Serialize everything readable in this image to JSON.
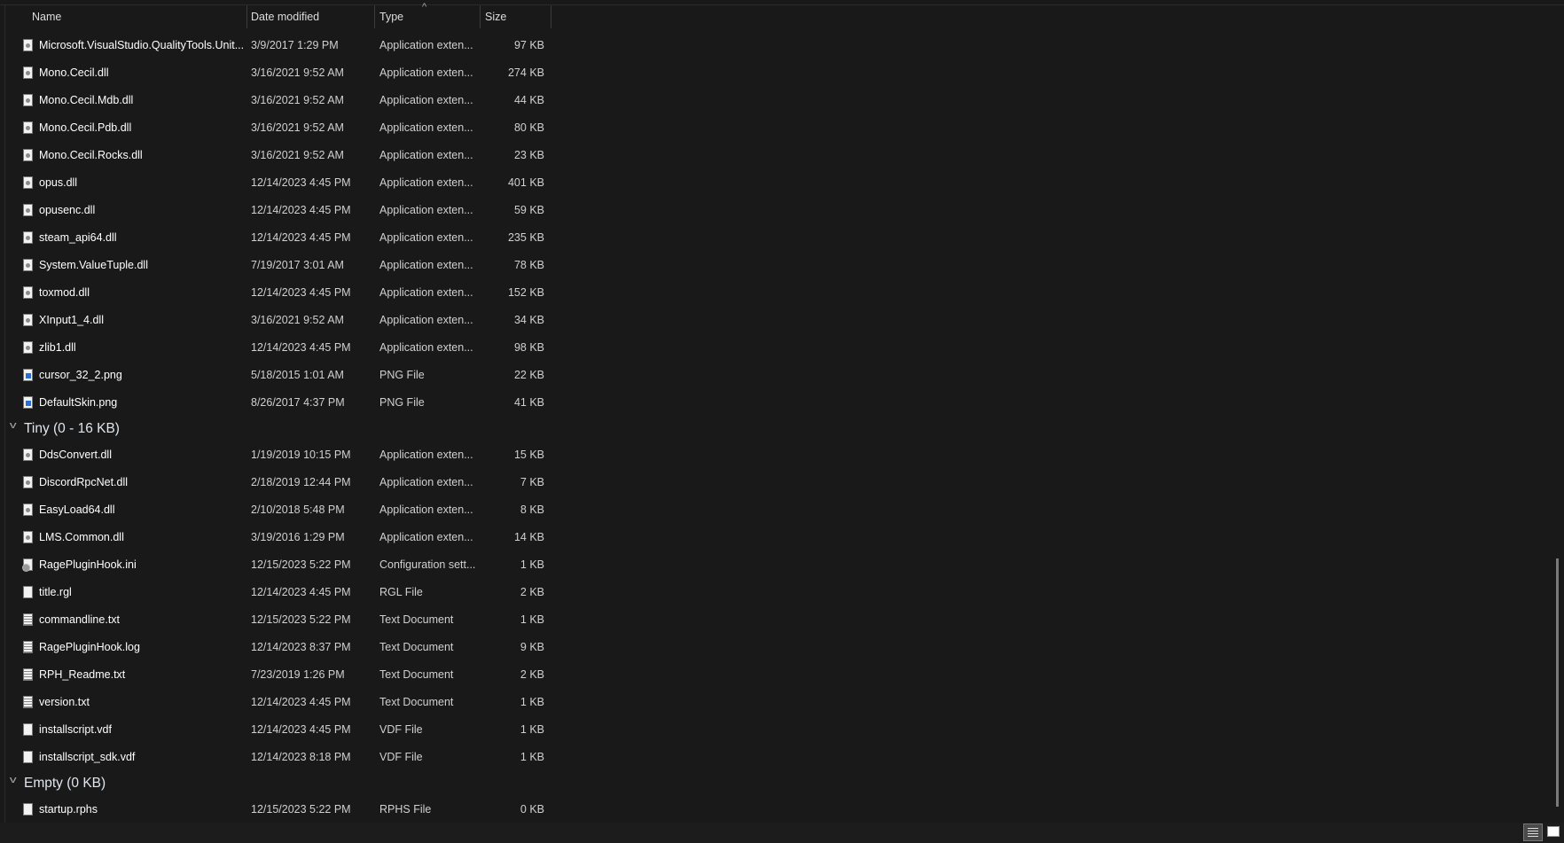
{
  "columns": {
    "name": "Name",
    "date": "Date modified",
    "type": "Type",
    "size": "Size",
    "sorted_by": "Type",
    "sort_icon": "chevron-up-icon"
  },
  "groups": [
    {
      "label": null,
      "items": [
        {
          "name": "Microsoft.VisualStudio.QualityTools.Unit...",
          "date": "3/9/2017 1:29 PM",
          "type": "Application exten...",
          "size": "97 KB",
          "icon": "dll"
        },
        {
          "name": "Mono.Cecil.dll",
          "date": "3/16/2021 9:52 AM",
          "type": "Application exten...",
          "size": "274 KB",
          "icon": "dll"
        },
        {
          "name": "Mono.Cecil.Mdb.dll",
          "date": "3/16/2021 9:52 AM",
          "type": "Application exten...",
          "size": "44 KB",
          "icon": "dll"
        },
        {
          "name": "Mono.Cecil.Pdb.dll",
          "date": "3/16/2021 9:52 AM",
          "type": "Application exten...",
          "size": "80 KB",
          "icon": "dll"
        },
        {
          "name": "Mono.Cecil.Rocks.dll",
          "date": "3/16/2021 9:52 AM",
          "type": "Application exten...",
          "size": "23 KB",
          "icon": "dll"
        },
        {
          "name": "opus.dll",
          "date": "12/14/2023 4:45 PM",
          "type": "Application exten...",
          "size": "401 KB",
          "icon": "dll"
        },
        {
          "name": "opusenc.dll",
          "date": "12/14/2023 4:45 PM",
          "type": "Application exten...",
          "size": "59 KB",
          "icon": "dll"
        },
        {
          "name": "steam_api64.dll",
          "date": "12/14/2023 4:45 PM",
          "type": "Application exten...",
          "size": "235 KB",
          "icon": "dll"
        },
        {
          "name": "System.ValueTuple.dll",
          "date": "7/19/2017 3:01 AM",
          "type": "Application exten...",
          "size": "78 KB",
          "icon": "dll"
        },
        {
          "name": "toxmod.dll",
          "date": "12/14/2023 4:45 PM",
          "type": "Application exten...",
          "size": "152 KB",
          "icon": "dll"
        },
        {
          "name": "XInput1_4.dll",
          "date": "3/16/2021 9:52 AM",
          "type": "Application exten...",
          "size": "34 KB",
          "icon": "dll"
        },
        {
          "name": "zlib1.dll",
          "date": "12/14/2023 4:45 PM",
          "type": "Application exten...",
          "size": "98 KB",
          "icon": "dll"
        },
        {
          "name": "cursor_32_2.png",
          "date": "5/18/2015 1:01 AM",
          "type": "PNG File",
          "size": "22 KB",
          "icon": "png"
        },
        {
          "name": "DefaultSkin.png",
          "date": "8/26/2017 4:37 PM",
          "type": "PNG File",
          "size": "41 KB",
          "icon": "png"
        }
      ]
    },
    {
      "label": "Tiny (0 - 16 KB)",
      "items": [
        {
          "name": "DdsConvert.dll",
          "date": "1/19/2019 10:15 PM",
          "type": "Application exten...",
          "size": "15 KB",
          "icon": "dll"
        },
        {
          "name": "DiscordRpcNet.dll",
          "date": "2/18/2019 12:44 PM",
          "type": "Application exten...",
          "size": "7 KB",
          "icon": "dll"
        },
        {
          "name": "EasyLoad64.dll",
          "date": "2/10/2018 5:48 PM",
          "type": "Application exten...",
          "size": "8 KB",
          "icon": "dll"
        },
        {
          "name": "LMS.Common.dll",
          "date": "3/19/2016 1:29 PM",
          "type": "Application exten...",
          "size": "14 KB",
          "icon": "dll"
        },
        {
          "name": "RagePluginHook.ini",
          "date": "12/15/2023 5:22 PM",
          "type": "Configuration sett...",
          "size": "1 KB",
          "icon": "ini"
        },
        {
          "name": "title.rgl",
          "date": "12/14/2023 4:45 PM",
          "type": "RGL File",
          "size": "2 KB",
          "icon": "blank"
        },
        {
          "name": "commandline.txt",
          "date": "12/15/2023 5:22 PM",
          "type": "Text Document",
          "size": "1 KB",
          "icon": "txt"
        },
        {
          "name": "RagePluginHook.log",
          "date": "12/14/2023 8:37 PM",
          "type": "Text Document",
          "size": "9 KB",
          "icon": "txt"
        },
        {
          "name": "RPH_Readme.txt",
          "date": "7/23/2019 1:26 PM",
          "type": "Text Document",
          "size": "2 KB",
          "icon": "txt"
        },
        {
          "name": "version.txt",
          "date": "12/14/2023 4:45 PM",
          "type": "Text Document",
          "size": "1 KB",
          "icon": "txt"
        },
        {
          "name": "installscript.vdf",
          "date": "12/14/2023 4:45 PM",
          "type": "VDF File",
          "size": "1 KB",
          "icon": "blank"
        },
        {
          "name": "installscript_sdk.vdf",
          "date": "12/14/2023 8:18 PM",
          "type": "VDF File",
          "size": "1 KB",
          "icon": "blank"
        }
      ]
    },
    {
      "label": "Empty (0 KB)",
      "items": [
        {
          "name": "startup.rphs",
          "date": "12/15/2023 5:22 PM",
          "type": "RPHS File",
          "size": "0 KB",
          "icon": "blank"
        }
      ]
    }
  ],
  "status_bar": {
    "views": [
      "details-view",
      "large-icons-view"
    ],
    "active_view": "details-view"
  }
}
